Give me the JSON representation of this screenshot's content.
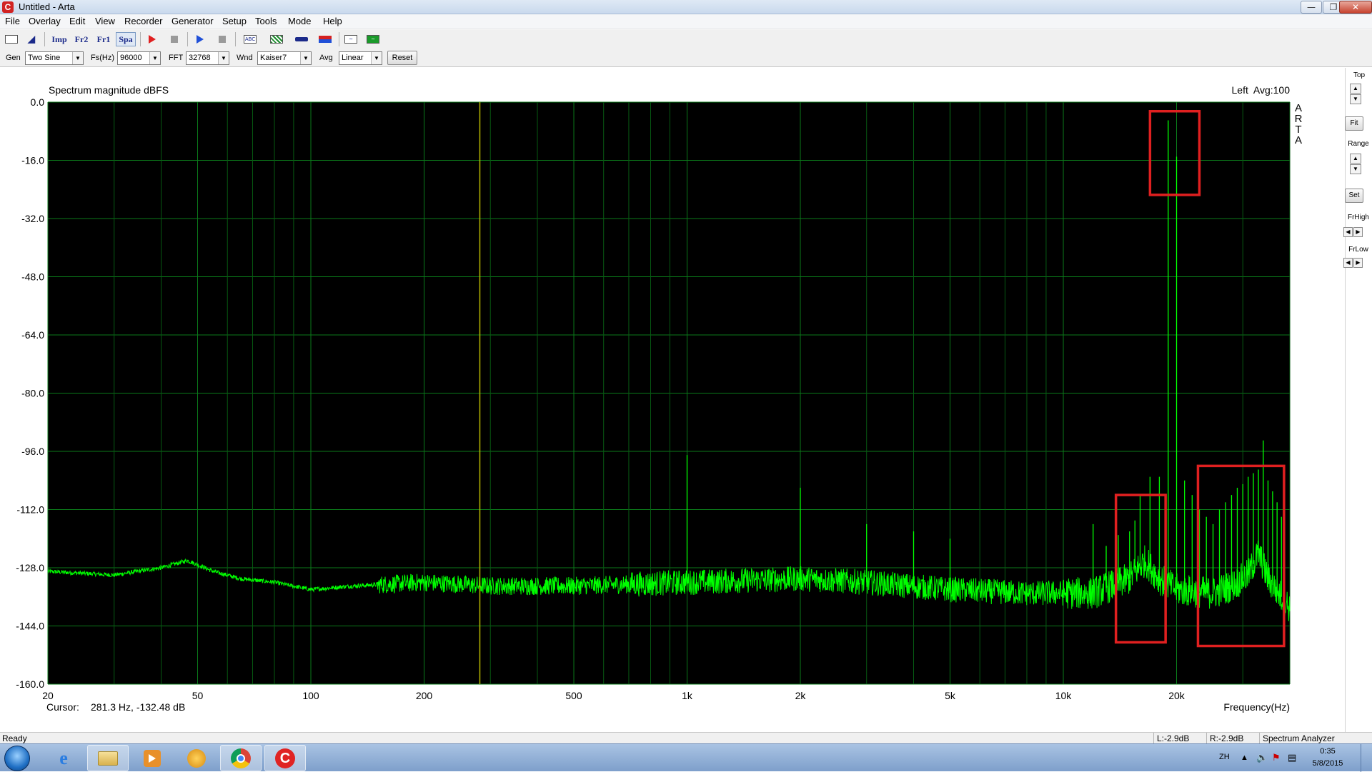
{
  "window": {
    "title": "Untitled - Arta",
    "app_icon": "C"
  },
  "menu": [
    "File",
    "Overlay",
    "Edit",
    "View",
    "Recorder",
    "Generator",
    "Setup",
    "Tools",
    "Mode",
    "Help"
  ],
  "toolbar": {
    "imp": "Imp",
    "fr2": "Fr2",
    "fr1": "Fr1",
    "spa": "Spa",
    "abc": "ABC"
  },
  "controls": {
    "gen_label": "Gen",
    "gen_value": "Two Sine",
    "fs_label": "Fs(Hz)",
    "fs_value": "96000",
    "fft_label": "FFT",
    "fft_value": "32768",
    "wnd_label": "Wnd",
    "wnd_value": "Kaiser7",
    "avg_label": "Avg",
    "avg_value": "Linear",
    "reset_label": "Reset"
  },
  "plot": {
    "title": "Spectrum magnitude dBFS",
    "channel_info": "Left  Avg:100",
    "arta_vertical": [
      "A",
      "R",
      "T",
      "A"
    ],
    "cursor_label": "Cursor:",
    "cursor_value": "281.3 Hz, -132.48 dB",
    "xlabel": "Frequency(Hz)",
    "y_ticks": [
      "0.0",
      "-16.0",
      "-32.0",
      "-48.0",
      "-64.0",
      "-80.0",
      "-96.0",
      "-112.0",
      "-128.0",
      "-144.0",
      "-160.0"
    ],
    "x_ticks": [
      "20",
      "50",
      "100",
      "200",
      "500",
      "1k",
      "2k",
      "5k",
      "10k",
      "20k"
    ],
    "colors": {
      "background": "#000000",
      "grid": "#0b7a1a",
      "trace": "#00ff00",
      "cursor": "#b8b800",
      "highlight": "#e02020"
    }
  },
  "chart_data": {
    "type": "line",
    "title": "Spectrum magnitude dBFS",
    "xlabel": "Frequency(Hz)",
    "ylabel": "",
    "xscale": "log",
    "xlim": [
      20,
      40000
    ],
    "ylim": [
      -160,
      0
    ],
    "grid": true,
    "cursor_x": 281.3,
    "noise_floor": [
      [
        20,
        -129
      ],
      [
        30,
        -130
      ],
      [
        40,
        -128
      ],
      [
        47,
        -126
      ],
      [
        55,
        -129
      ],
      [
        65,
        -131
      ],
      [
        80,
        -132
      ],
      [
        100,
        -134
      ],
      [
        130,
        -133
      ],
      [
        200,
        -132
      ],
      [
        300,
        -133
      ],
      [
        500,
        -133
      ],
      [
        1000,
        -132
      ],
      [
        2000,
        -131
      ],
      [
        3000,
        -132
      ],
      [
        5000,
        -134
      ],
      [
        8000,
        -135
      ],
      [
        12000,
        -135
      ],
      [
        15000,
        -131
      ],
      [
        16500,
        -126
      ],
      [
        18000,
        -131
      ],
      [
        20000,
        -134
      ],
      [
        25000,
        -135
      ],
      [
        28000,
        -133
      ],
      [
        31000,
        -130
      ],
      [
        33000,
        -124
      ],
      [
        35000,
        -131
      ],
      [
        38000,
        -136
      ],
      [
        40000,
        -139
      ]
    ],
    "peaks": [
      [
        1000,
        -97
      ],
      [
        2000,
        -106
      ],
      [
        3000,
        -116
      ],
      [
        4000,
        -118
      ],
      [
        5000,
        -120
      ],
      [
        12000,
        -116
      ],
      [
        13000,
        -122
      ],
      [
        14000,
        -119
      ],
      [
        15000,
        -118
      ],
      [
        15500,
        -115
      ],
      [
        16000,
        -108
      ],
      [
        17000,
        -103
      ],
      [
        18000,
        -103
      ],
      [
        19000,
        -5
      ],
      [
        20000,
        -15
      ],
      [
        21000,
        -104
      ],
      [
        22000,
        -108
      ],
      [
        23000,
        -112
      ],
      [
        24000,
        -114
      ],
      [
        25000,
        -116
      ],
      [
        26000,
        -112
      ],
      [
        27000,
        -110
      ],
      [
        28000,
        -108
      ],
      [
        29000,
        -106
      ],
      [
        30000,
        -105
      ],
      [
        31000,
        -103
      ],
      [
        32000,
        -102
      ],
      [
        33000,
        -101
      ],
      [
        34000,
        -93
      ],
      [
        35000,
        -104
      ],
      [
        36000,
        -107
      ],
      [
        37000,
        -110
      ],
      [
        38000,
        -114
      ]
    ],
    "annotation_boxes": [
      {
        "f_min": 17000,
        "f_max": 23000,
        "db_max": -2.5,
        "db_min": -25.5
      },
      {
        "f_min": 13800,
        "f_max": 18700,
        "db_max": -108,
        "db_min": -148.5
      },
      {
        "f_min": 22800,
        "f_max": 38600,
        "db_max": -100,
        "db_min": -149.5
      }
    ]
  },
  "right_panel": {
    "top_label": "Top",
    "fit_label": "Fit",
    "range_label": "Range",
    "set_label": "Set",
    "frhigh_label": "FrHigh",
    "frlow_label": "FrLow"
  },
  "status": {
    "ready": "Ready",
    "left_level": "L:-2.9dB",
    "right_level": "R:-2.9dB",
    "mode": "Spectrum Analyzer"
  },
  "taskbar": {
    "items": [
      "start",
      "internet-explorer",
      "file-explorer",
      "media-player",
      "finder-app",
      "chrome",
      "arta"
    ],
    "lang": "ZH",
    "time": "0:35",
    "date": "5/8/2015"
  }
}
